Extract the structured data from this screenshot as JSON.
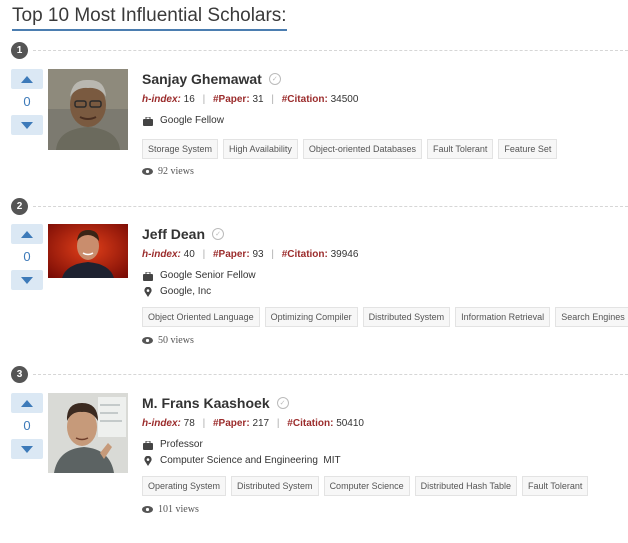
{
  "page": {
    "title": "Top 10 Most Influential Scholars:"
  },
  "labels": {
    "hindex": "h-index:",
    "paper": "#Paper:",
    "citation": "#Citation:",
    "sep": "|"
  },
  "colors": {
    "accent": "#3d7ab9",
    "stat_label": "#9b2c2c",
    "vote_bg": "#dbe8f4",
    "badge": "#555555"
  },
  "icons": {
    "upvote": "chevron-up-icon",
    "downvote": "chevron-down-icon",
    "title": "briefcase-icon",
    "location": "map-pin-icon",
    "views": "eye-icon",
    "verified": "check-circle-icon"
  },
  "scholars": [
    {
      "rank": "1",
      "votes": "0",
      "name": "Sanjay Ghemawat",
      "hindex": "16",
      "papers": "31",
      "citations": "34500",
      "title": "Google Fellow",
      "tags": [
        "Storage System",
        "High Availability",
        "Object-oriented Databases",
        "Fault Tolerant",
        "Feature Set"
      ],
      "views": "92 views"
    },
    {
      "rank": "2",
      "votes": "0",
      "name": "Jeff Dean",
      "hindex": "40",
      "papers": "93",
      "citations": "39946",
      "title": "Google Senior Fellow",
      "affiliation": "Google, Inc",
      "tags": [
        "Object Oriented Language",
        "Optimizing Compiler",
        "Distributed System",
        "Information Retrieval",
        "Search Engines"
      ],
      "views": "50 views"
    },
    {
      "rank": "3",
      "votes": "0",
      "name": "M. Frans Kaashoek",
      "hindex": "78",
      "papers": "217",
      "citations": "50410",
      "title": "Professor",
      "affiliation": "Computer Science and Engineering  MIT",
      "tags": [
        "Operating System",
        "Distributed System",
        "Computer Science",
        "Distributed Hash Table",
        "Fault Tolerant"
      ],
      "views": "101 views"
    }
  ]
}
